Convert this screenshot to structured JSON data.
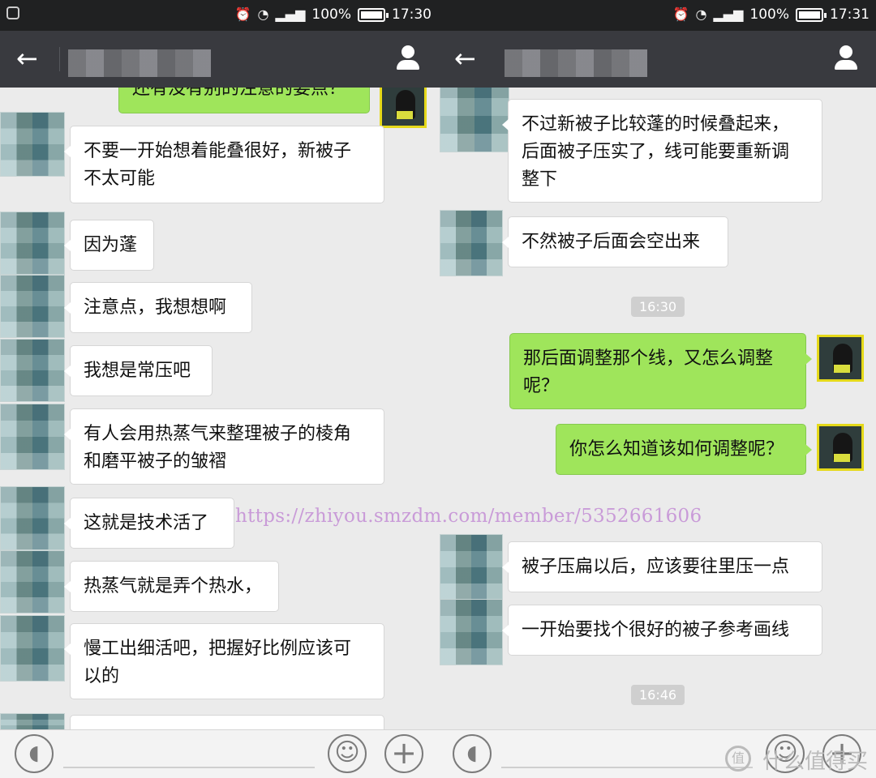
{
  "watermark": "https://zhiyou.smzdm.com/member/5352661606",
  "left": {
    "status": {
      "battery": "100%",
      "time": "17:30"
    },
    "messages": [
      {
        "side": "me",
        "text": "还有没有别的注意的要点？"
      },
      {
        "side": "other",
        "text": "不要一开始想着能叠很好，新被子\n不太可能"
      },
      {
        "side": "other",
        "text": "因为蓬"
      },
      {
        "side": "other",
        "text": "注意点，我想想啊"
      },
      {
        "side": "other",
        "text": "我想是常压吧"
      },
      {
        "side": "other",
        "text": "有人会用热蒸气来整理被子的棱角\n和磨平被子的皱褶"
      },
      {
        "side": "other",
        "text": "这就是技术活了"
      },
      {
        "side": "other",
        "text": "热蒸气就是弄个热水，"
      },
      {
        "side": "other",
        "text": "慢工出细活吧，把握好比例应该可\n以的"
      }
    ]
  },
  "right": {
    "status": {
      "battery": "100%",
      "time": "17:31"
    },
    "messages": [
      {
        "side": "other",
        "text": "不过新被子比较蓬的时候叠起来，\n后面被子压实了，线可能要重新调\n整下"
      },
      {
        "side": "other",
        "text": "不然被子后面会空出来"
      },
      {
        "side": "time",
        "text": "16:30"
      },
      {
        "side": "me",
        "text": "那后面调整那个线，又怎么调整\n呢？"
      },
      {
        "side": "me",
        "text": "你怎么知道该如何调整呢？"
      },
      {
        "side": "other",
        "text": "被子压扁以后，应该要往里压一点"
      },
      {
        "side": "other",
        "text": "一开始要找个很好的被子参考画线"
      },
      {
        "side": "time",
        "text": "16:46"
      }
    ]
  },
  "icons": [
    "back-arrow-icon",
    "user-profile-icon",
    "voice-input-icon",
    "emoji-icon",
    "plus-icon",
    "alarm-icon",
    "wifi-icon",
    "signal-icon",
    "battery-icon"
  ],
  "corner_mark": "什么值得买"
}
